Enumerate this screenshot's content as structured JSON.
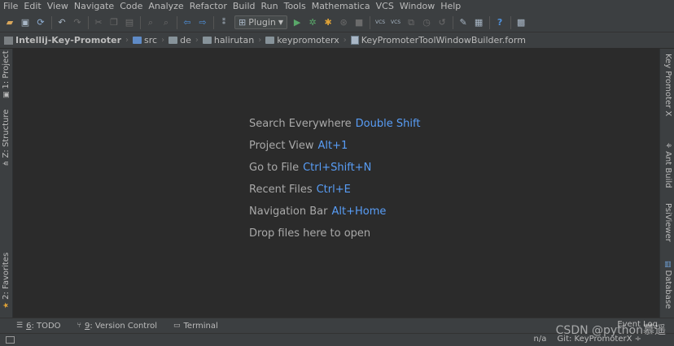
{
  "menu": [
    "File",
    "Edit",
    "View",
    "Navigate",
    "Code",
    "Analyze",
    "Refactor",
    "Build",
    "Run",
    "Tools",
    "Mathematica",
    "VCS",
    "Window",
    "Help"
  ],
  "toolbar": {
    "run_config": "Plugin",
    "vcs_label": "VCS"
  },
  "breadcrumbs": [
    "Intellij-Key-Promoter",
    "src",
    "de",
    "halirutan",
    "keypromoterx",
    "KeyPromoterToolWindowBuilder.form"
  ],
  "left_tabs": [
    "1: Project",
    "Z: Structure",
    "2: Favorites"
  ],
  "right_tabs": [
    "Key Promoter X",
    "Ant Build",
    "PsiViewer",
    "Database"
  ],
  "hints": [
    {
      "label": "Search Everywhere",
      "key": "Double Shift"
    },
    {
      "label": "Project View",
      "key": "Alt+1"
    },
    {
      "label": "Go to File",
      "key": "Ctrl+Shift+N"
    },
    {
      "label": "Recent Files",
      "key": "Ctrl+E"
    },
    {
      "label": "Navigation Bar",
      "key": "Alt+Home"
    },
    {
      "label": "Drop files here to open",
      "key": ""
    }
  ],
  "tool_windows": {
    "todo_num": "6",
    "todo_label": ": TODO",
    "vc_num": "9",
    "vc_label": ": Version Control",
    "terminal": "Terminal",
    "event_log": "Event Log"
  },
  "status": {
    "na": "n/a",
    "git": "Git: KeyPromoterX ÷"
  },
  "watermark": "CSDN @python慕遥",
  "colors": {
    "editor_bg": "#2b2b2b",
    "panel_bg": "#3c3f41",
    "shortcut": "#589df6"
  }
}
